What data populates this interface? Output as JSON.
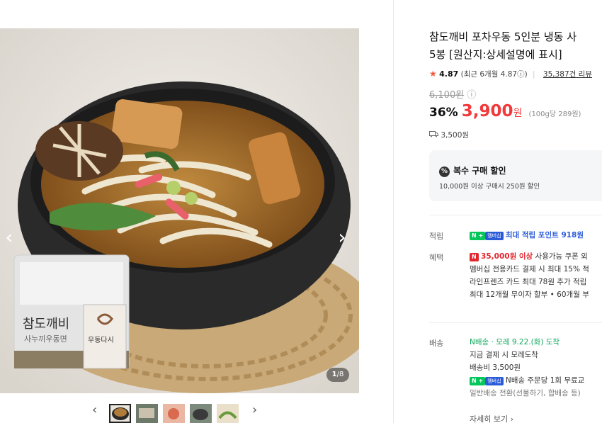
{
  "gallery": {
    "counter_current": "1",
    "counter_total": "/8",
    "prev_arrow": "‹",
    "next_arrow": "›",
    "package_brand": "참도깨비",
    "package_sub": "사누끼우동면",
    "sachet_label": "우동다시",
    "thumb_prev": "‹",
    "thumb_next": "›"
  },
  "product": {
    "title_line1": "참도깨비 포차우동 5인분 냉동 사",
    "title_line2": "5봉 [원산지:상세설명에 표시]",
    "rating_star": "★",
    "rating_score": "4.87",
    "rating_recent": "(최근 6개월 4.87ⓘ)",
    "review_link": "35,387건 리뷰",
    "original_price": "6,100원",
    "original_info": "ⓘ",
    "discount_pct": "36%",
    "sale_price": "3,900",
    "sale_won": "원",
    "unit_price": "(100g당 289원)",
    "shipping_fee": "3,500원"
  },
  "coupon": {
    "icon": "%",
    "title": "복수 구매 할인",
    "desc": "10,000원 이상 구매시 250원 할인"
  },
  "points": {
    "label": "적립",
    "badge_n": "N +",
    "badge_plus": "멤버십",
    "text": "최대 적립 포인트 918원"
  },
  "benefits": {
    "label": "혜택",
    "badge": "N",
    "highlight": "35,000원 이상",
    "line1_rest": "사용가능 쿠폰 외",
    "line2": "멤버십 전용카드 결제 시 최대 15% 적",
    "line3": "라인프렌즈 카드 최대 78원 추가 적립",
    "line4": "최대 12개월 무이자 할부 • 60개월 부"
  },
  "delivery": {
    "label": "배송",
    "npay_badge": "N",
    "type": "배송",
    "arrival": "· 모레 9.22.(화) 도착",
    "line2": "지금 결제 시 모레도착",
    "line3": "배송비 3,500원",
    "badge_n": "N +",
    "badge_plus": "멤버십",
    "line4": "N배송 주문당 1회 무료교",
    "line5": "일반배송 전환(선물하기, 합배송 등)",
    "more": "자세히 보기 ›"
  }
}
